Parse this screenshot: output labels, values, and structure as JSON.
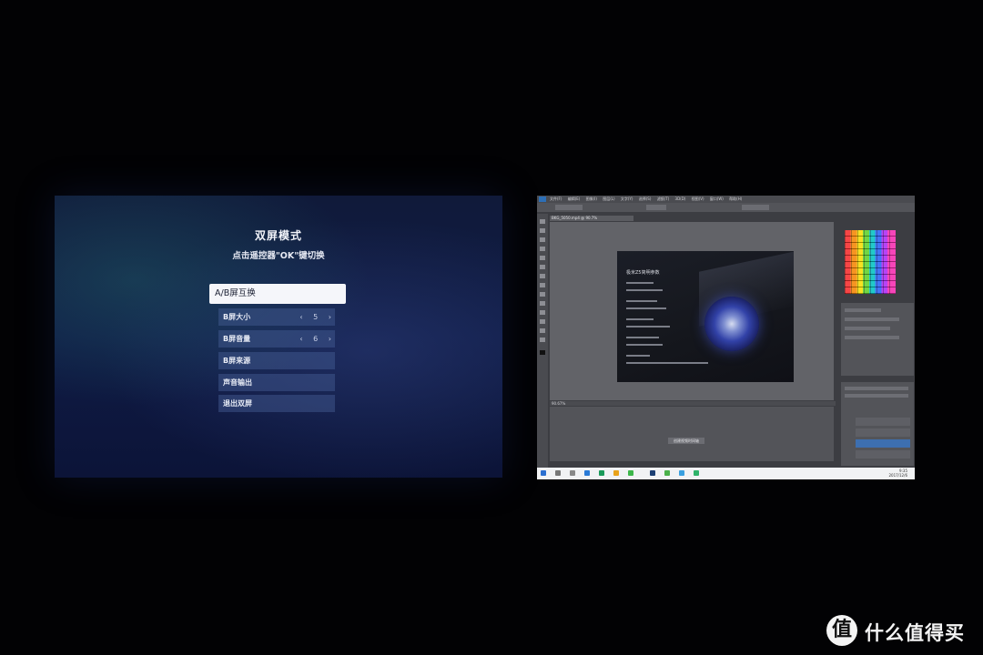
{
  "screen_a": {
    "title": "双屏模式",
    "subtitle": "点击遥控器\"OK\"键切换",
    "menu": [
      {
        "label": "A/B屏互换",
        "selected": true
      },
      {
        "label": "B屏大小",
        "value": "5"
      },
      {
        "label": "B屏音量",
        "value": "6"
      },
      {
        "label": "B屏来源"
      },
      {
        "label": "声音输出"
      },
      {
        "label": "退出双屏"
      }
    ],
    "arrow_left": "‹",
    "arrow_right": "›"
  },
  "screen_b": {
    "app": "Photoshop",
    "logo": "Ps",
    "menu_items": [
      "文件(F)",
      "编辑(E)",
      "图像(I)",
      "图层(L)",
      "文字(Y)",
      "选择(S)",
      "滤镜(T)",
      "3D(D)",
      "视图(V)",
      "窗口(W)",
      "帮助(H)"
    ],
    "doc_tab": "BKG_5050.mp4 @ 90.7%",
    "image_title": "极米Z5简明参数",
    "status_zoom": "90.67%",
    "timeline_button": "创建视频时间轴",
    "taskbar_time": "9:35",
    "taskbar_date": "2017/12/6"
  },
  "watermark": {
    "logo_glyph": "值",
    "text": "什么值得买"
  }
}
